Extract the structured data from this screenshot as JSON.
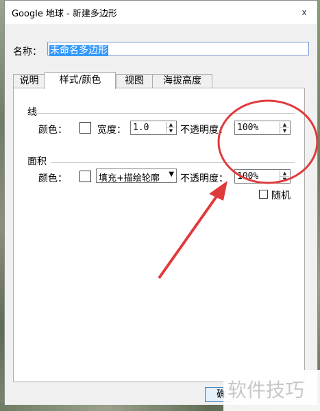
{
  "window": {
    "title": "Google 地球 - 新建多边形",
    "close_label": "x"
  },
  "name_field": {
    "label": "名称：",
    "value": "未命名多边形"
  },
  "tabs": [
    {
      "label": "说明"
    },
    {
      "label": "样式/颜色"
    },
    {
      "label": "视图"
    },
    {
      "label": "海拔高度"
    }
  ],
  "line_group": {
    "title": "线",
    "color_label": "颜色：",
    "width_label": "宽度：",
    "width_value": "1.0",
    "opacity_label": "不透明度：",
    "opacity_value": "100%"
  },
  "area_group": {
    "title": "面积",
    "color_label": "颜色：",
    "fill_mode": "填充+描绘轮廓",
    "opacity_label": "不透明度：",
    "opacity_value": "100%",
    "random_label": "随机"
  },
  "ok_button": {
    "label": "确定"
  },
  "watermark": {
    "text": "软件技巧"
  },
  "annotation": {
    "color": "#e03a3a"
  }
}
